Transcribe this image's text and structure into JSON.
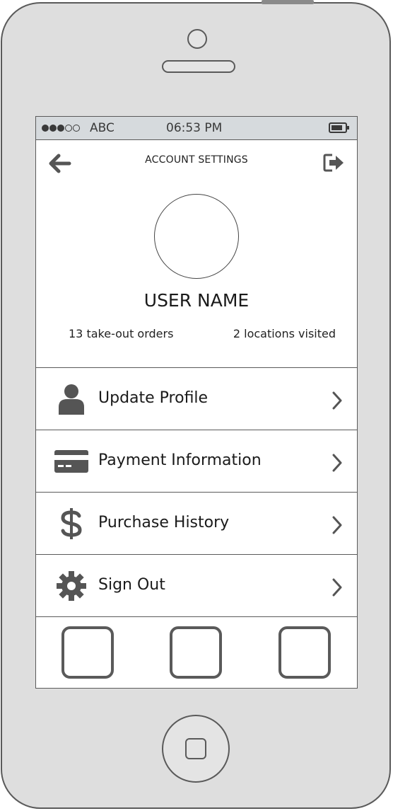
{
  "status_bar": {
    "carrier": "ABC",
    "time": "06:53 PM",
    "signal_strength": 3,
    "signal_total": 5
  },
  "nav": {
    "title": "ACCOUNT SETTINGS",
    "back_icon": "arrow-left-icon",
    "action_icon": "sign-out-icon"
  },
  "profile": {
    "user_name": "USER NAME",
    "stats": {
      "orders": "13 take-out orders",
      "locations": "2 locations visited"
    }
  },
  "menu": {
    "items": [
      {
        "label": "Update Profile",
        "icon": "user-icon"
      },
      {
        "label": "Payment Information",
        "icon": "credit-card-icon"
      },
      {
        "label": "Purchase History",
        "icon": "dollar-icon"
      },
      {
        "label": "Sign Out",
        "icon": "gear-icon"
      }
    ]
  },
  "colors": {
    "device_body": "#dedede",
    "outline": "#5a5a5a",
    "status_bar": "#d6dadd",
    "icon": "#555555"
  }
}
